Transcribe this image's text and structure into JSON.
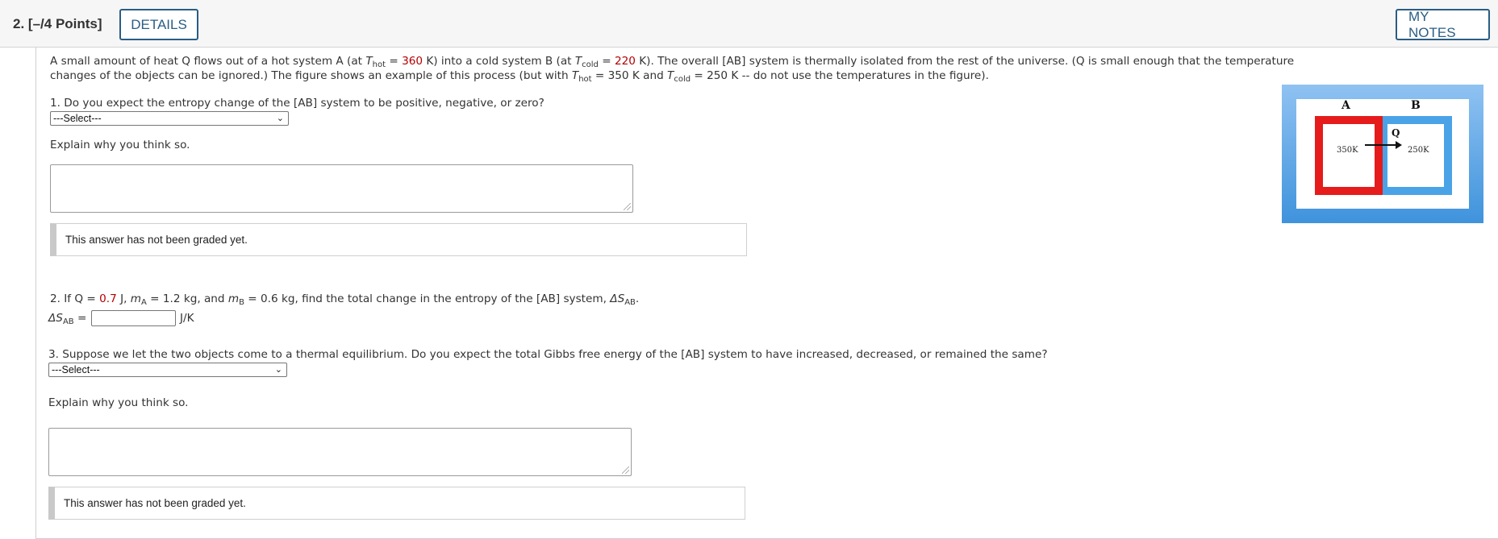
{
  "header": {
    "question_number": "2.",
    "points": "[–/4 Points]",
    "details_label": "DETAILS",
    "my_notes_label": "MY NOTES"
  },
  "intro": {
    "line1_a": "A small amount of heat Q flows out of a hot system A (at ",
    "T": "T",
    "hot": "hot",
    "cold": "cold",
    "eq": " = ",
    "t_hot_value": "360",
    "line1_b": " K) into a cold system B (at ",
    "t_cold_value": "220",
    "line1_c": " K). The overall [AB] system is thermally isolated from the rest of the universe. (Q is small enough that the temperature",
    "line2_a": "changes of the objects can be ignored.) The figure shows an example of this process (but with ",
    "line2_b": " = 350 K and ",
    "line2_c": " = 250 K -- do not use the temperatures in the figure)."
  },
  "part1": {
    "question": "1. Do you expect the entropy change of the [AB] system to be positive, negative, or zero?",
    "select_value": "---Select---",
    "explain_label": "Explain why you think so.",
    "graded_text": "This answer has not been graded yet."
  },
  "part2": {
    "q_a": "2. If Q = ",
    "q_value": "0.7",
    "q_b": " J, ",
    "m": "m",
    "sub_A": "A",
    "sub_B": "B",
    "q_c": " = 1.2 kg, and ",
    "q_d": " = 0.6 kg, find the total change in the entropy of the [AB] system, ",
    "delta_s": "ΔS",
    "sub_AB": "AB",
    "period": ".",
    "answer_label_eq": " =",
    "unit": "J/K"
  },
  "part3": {
    "question": "3. Suppose we let the two objects come to a thermal equilibrium. Do you expect the total Gibbs free energy of the [AB] system to have increased, decreased, or remained the same?",
    "select_value": "---Select---",
    "explain_label": "Explain why you think so.",
    "graded_text": "This answer has not been graded yet."
  },
  "figure": {
    "label_a": "A",
    "label_b": "B",
    "label_q": "Q",
    "temp_a": "350K",
    "temp_b": "250K",
    "colors": {
      "hot": "#e61b1b",
      "cold": "#4aa3e6",
      "background": "#5aa6e6"
    }
  }
}
